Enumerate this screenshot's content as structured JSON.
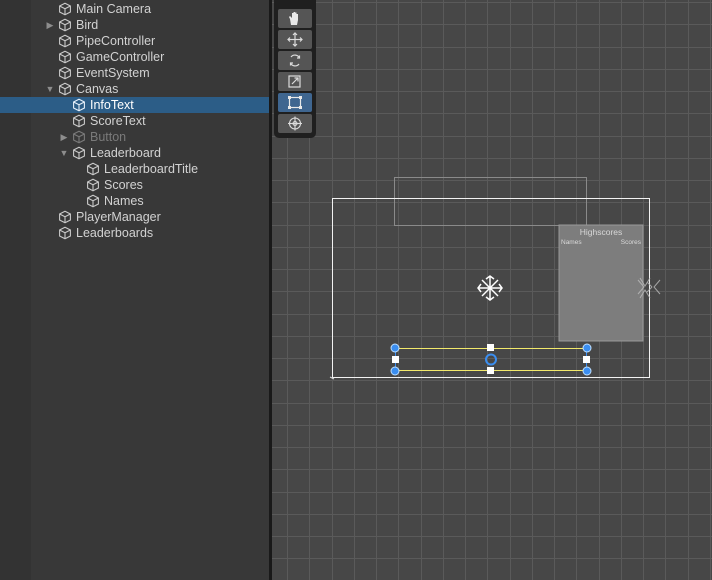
{
  "hierarchy": {
    "items": [
      {
        "label": "Main Camera",
        "depth": 0,
        "expander": "none"
      },
      {
        "label": "Bird",
        "depth": 0,
        "expander": "collapsed"
      },
      {
        "label": "PipeController",
        "depth": 0,
        "expander": "none"
      },
      {
        "label": "GameController",
        "depth": 0,
        "expander": "none"
      },
      {
        "label": "EventSystem",
        "depth": 0,
        "expander": "none"
      },
      {
        "label": "Canvas",
        "depth": 0,
        "expander": "expanded"
      },
      {
        "label": "InfoText",
        "depth": 1,
        "expander": "none",
        "selected": true
      },
      {
        "label": "ScoreText",
        "depth": 1,
        "expander": "none"
      },
      {
        "label": "Button",
        "depth": 1,
        "expander": "collapsed",
        "disabled": true
      },
      {
        "label": "Leaderboard",
        "depth": 1,
        "expander": "expanded"
      },
      {
        "label": "LeaderboardTitle",
        "depth": 2,
        "expander": "none"
      },
      {
        "label": "Scores",
        "depth": 2,
        "expander": "none"
      },
      {
        "label": "Names",
        "depth": 2,
        "expander": "none"
      },
      {
        "label": "PlayerManager",
        "depth": 0,
        "expander": "none"
      },
      {
        "label": "Leaderboards",
        "depth": 0,
        "expander": "none"
      }
    ]
  },
  "toolbar": {
    "tools": [
      {
        "name": "hand-tool",
        "icon": "hand-icon"
      },
      {
        "name": "move-tool",
        "icon": "move-icon"
      },
      {
        "name": "rotate-tool",
        "icon": "rotate-icon"
      },
      {
        "name": "scale-tool",
        "icon": "scale-icon"
      },
      {
        "name": "rect-tool",
        "icon": "rect-icon",
        "active": true
      },
      {
        "name": "transform-tool",
        "icon": "transform-icon"
      }
    ]
  },
  "scene": {
    "leaderboard": {
      "title": "Highscores",
      "names_header": "Names",
      "scores_header": "Scores"
    }
  },
  "colors": {
    "selection": "#2c5d87",
    "grid_line": "#5a5a5a",
    "scene_bg": "#474747",
    "gizmo_blue": "#3b8ef0",
    "rect_yellow": "#f2e96b"
  }
}
